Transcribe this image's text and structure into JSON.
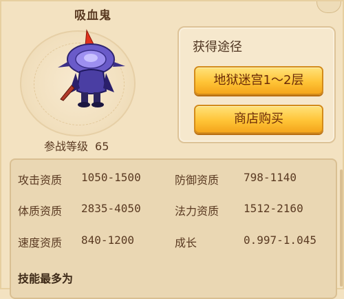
{
  "pet": {
    "name": "吸血鬼",
    "combat_level_label": "参战等级",
    "combat_level_value": "65"
  },
  "source": {
    "title": "获得途径",
    "buttons": [
      "地狱迷宫1～2层",
      "商店购买"
    ]
  },
  "stats": {
    "rows": [
      {
        "label1": "攻击资质",
        "value1": "1050-1500",
        "label2": "防御资质",
        "value2": "798-1140"
      },
      {
        "label1": "体质资质",
        "value1": "2835-4050",
        "label2": "法力资质",
        "value2": "1512-2160"
      },
      {
        "label1": "速度资质",
        "value1": "840-1200",
        "label2": "成长",
        "value2": "0.997-1.045"
      }
    ],
    "skills_title": "技能最多为"
  },
  "colors": {
    "background": "#f3e2c1",
    "button_gold": "#ffc437",
    "text_brown": "#5a3a22"
  }
}
